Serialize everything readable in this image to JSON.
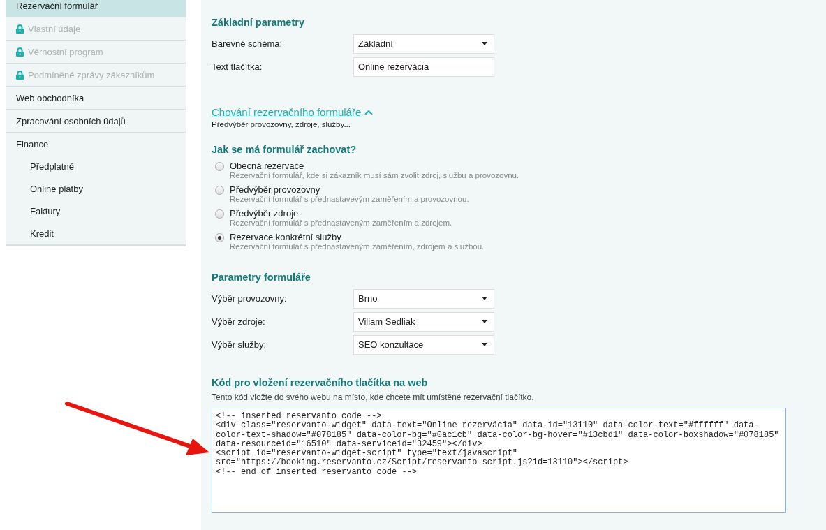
{
  "sidebar": {
    "items": [
      {
        "label": "Rezervační formulář",
        "selected": true,
        "locked": false
      },
      {
        "label": "Vlastní údaje",
        "selected": false,
        "locked": true
      },
      {
        "label": "Věrnostní program",
        "selected": false,
        "locked": true
      },
      {
        "label": "Podmíněné zprávy zákazníkům",
        "selected": false,
        "locked": true
      },
      {
        "label": "Web obchodníka",
        "selected": false,
        "locked": false
      },
      {
        "label": "Zpracování osobních údajů",
        "selected": false,
        "locked": false
      },
      {
        "label": "Finance",
        "selected": false,
        "locked": false,
        "children": [
          {
            "label": "Předplatné",
            "selected": false
          },
          {
            "label": "Online platby",
            "selected": false
          },
          {
            "label": "Faktury",
            "selected": false
          },
          {
            "label": "Kredit",
            "selected": false
          }
        ]
      }
    ]
  },
  "basic": {
    "heading": "Základní parametry",
    "fields": [
      {
        "kind": "select",
        "label": "Barevné schéma:",
        "value": "Základní"
      },
      {
        "kind": "text",
        "label": "Text tlačítka:",
        "value": "Online rezervácia"
      }
    ]
  },
  "behavior_toggle": {
    "label": "Chování rezervačního formuláře",
    "expanded": true,
    "hint": "Předvýběr provozovny, zdroje, služby..."
  },
  "behavior": {
    "heading": "Jak se má formulář zachovat?",
    "options": [
      {
        "label": "Obecná rezervace",
        "description": "Rezervační formulář, kde si zákazník musí sám zvolit zdroj, službu a provozovnu.",
        "selected": false
      },
      {
        "label": "Předvýběr provozovny",
        "description": "Rezervační formulář s přednastavevým zaměřením a provozovnou.",
        "selected": false
      },
      {
        "label": "Předvýběr zdroje",
        "description": "Rezervační formulář s přednastaveným zaměřením a zdrojem.",
        "selected": false
      },
      {
        "label": "Rezervace konkrétní služby",
        "description": "Rezervační formulář s přednastaveným zaměřením, zdrojem a službou.",
        "selected": true
      }
    ]
  },
  "form_params": {
    "heading": "Parametry formuláře",
    "fields": [
      {
        "kind": "select",
        "label": "Výběr provozovny:",
        "value": "Brno"
      },
      {
        "kind": "select",
        "label": "Výběr zdroje:",
        "value": "Viliam Sedliak"
      },
      {
        "kind": "select",
        "label": "Výběr služby:",
        "value": "SEO konzultace"
      }
    ]
  },
  "embed": {
    "heading": "Kód pro vložení rezervačního tlačítka na web",
    "description": "Tento kód vložte do svého webu na místo, kde chcete mít umístěné rezervační tlačítko.",
    "code_lines": [
      "<!-- inserted reservanto code -->",
      "<div class=\"reservanto-widget\" data-text=\"Online rezervácia\" data-id=\"13110\" data-color-text=\"#ffffff\" data-",
      "color-text-shadow=\"#078185\" data-color-bg=\"#0ac1cb\" data-color-bg-hover=\"#13cbd1\" data-color-boxshadow=\"#078185\"",
      "data-resourceid=\"16510\" data-serviceid=\"32459\"></div>",
      "<script id=\"reservanto-widget-script\" type=\"text/javascript\"",
      "src=\"https://booking.reservanto.cz/Script/reservanto-script.js?id=13110\"></script>",
      "<!-- end of inserted reservanto code -->"
    ]
  }
}
